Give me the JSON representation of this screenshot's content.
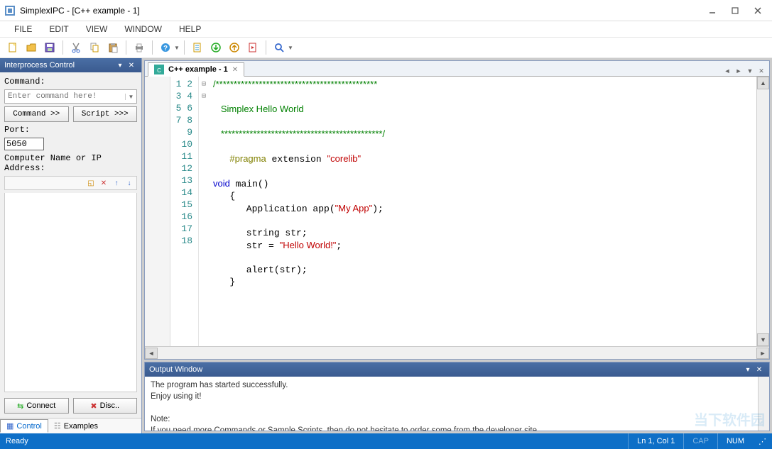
{
  "window": {
    "title": "SimplexIPC - [C++ example - 1]"
  },
  "menu": {
    "items": [
      "FILE",
      "EDIT",
      "VIEW",
      "WINDOW",
      "HELP"
    ]
  },
  "toolbar": {
    "icons": [
      "new-file",
      "open-folder",
      "save",
      "cut",
      "copy",
      "paste",
      "print",
      "help",
      "new-doc2",
      "run-down",
      "run-up",
      "exec",
      "search"
    ]
  },
  "ipc": {
    "header": "Interprocess Control",
    "cmd_label": "Command:",
    "cmd_placeholder": "Enter command here!",
    "btn_command": "Command >>",
    "btn_script": "Script >>>",
    "port_label": "Port:",
    "port_value": "5050",
    "addr_label": "Computer Name or IP Address:",
    "btn_connect": "Connect",
    "btn_disc": "Disc..",
    "tabs": {
      "control": "Control",
      "examples": "Examples"
    }
  },
  "editor": {
    "tab_label": "C++ example - 1",
    "lines": [
      {
        "n": 1,
        "seg": [
          {
            "t": "/*********************************************",
            "c": "cmt"
          }
        ]
      },
      {
        "n": 2,
        "seg": []
      },
      {
        "n": 3,
        "seg": [
          {
            "t": "   Simplex Hello World",
            "c": "cmt"
          }
        ]
      },
      {
        "n": 4,
        "seg": []
      },
      {
        "n": 5,
        "seg": [
          {
            "t": "   *********************************************/",
            "c": "cmt"
          }
        ]
      },
      {
        "n": 6,
        "seg": []
      },
      {
        "n": 7,
        "seg": [
          {
            "t": "   ",
            "c": ""
          },
          {
            "t": "#pragma",
            "c": "pre"
          },
          {
            "t": " extension ",
            "c": ""
          },
          {
            "t": "\"corelib\"",
            "c": "str"
          }
        ]
      },
      {
        "n": 8,
        "seg": []
      },
      {
        "n": 9,
        "seg": [
          {
            "t": "void",
            "c": "kw"
          },
          {
            "t": " main()",
            "c": ""
          }
        ]
      },
      {
        "n": 10,
        "seg": [
          {
            "t": "   {",
            "c": ""
          }
        ]
      },
      {
        "n": 11,
        "seg": [
          {
            "t": "      Application app(",
            "c": ""
          },
          {
            "t": "\"My App\"",
            "c": "str"
          },
          {
            "t": ");",
            "c": ""
          }
        ]
      },
      {
        "n": 12,
        "seg": []
      },
      {
        "n": 13,
        "seg": [
          {
            "t": "      string str;",
            "c": ""
          }
        ]
      },
      {
        "n": 14,
        "seg": [
          {
            "t": "      str = ",
            "c": ""
          },
          {
            "t": "\"Hello World!\"",
            "c": "str"
          },
          {
            "t": ";",
            "c": ""
          }
        ]
      },
      {
        "n": 15,
        "seg": []
      },
      {
        "n": 16,
        "seg": [
          {
            "t": "      alert(str);",
            "c": ""
          }
        ]
      },
      {
        "n": 17,
        "seg": [
          {
            "t": "   }",
            "c": ""
          }
        ]
      },
      {
        "n": 18,
        "seg": []
      }
    ],
    "fold_marks": {
      "1": "⊟",
      "9": "⊟"
    }
  },
  "output": {
    "header": "Output Window",
    "lines": [
      "The program has started successfully.",
      "Enjoy using it!",
      "",
      "Note:",
      "If you need more Commands or Sample Scripts, then do not hesitate to order some from the developer site"
    ]
  },
  "status": {
    "ready": "Ready",
    "pos": "Ln 1, Col 1",
    "cap": "CAP",
    "num": "NUM"
  },
  "watermark": "当下软件园"
}
